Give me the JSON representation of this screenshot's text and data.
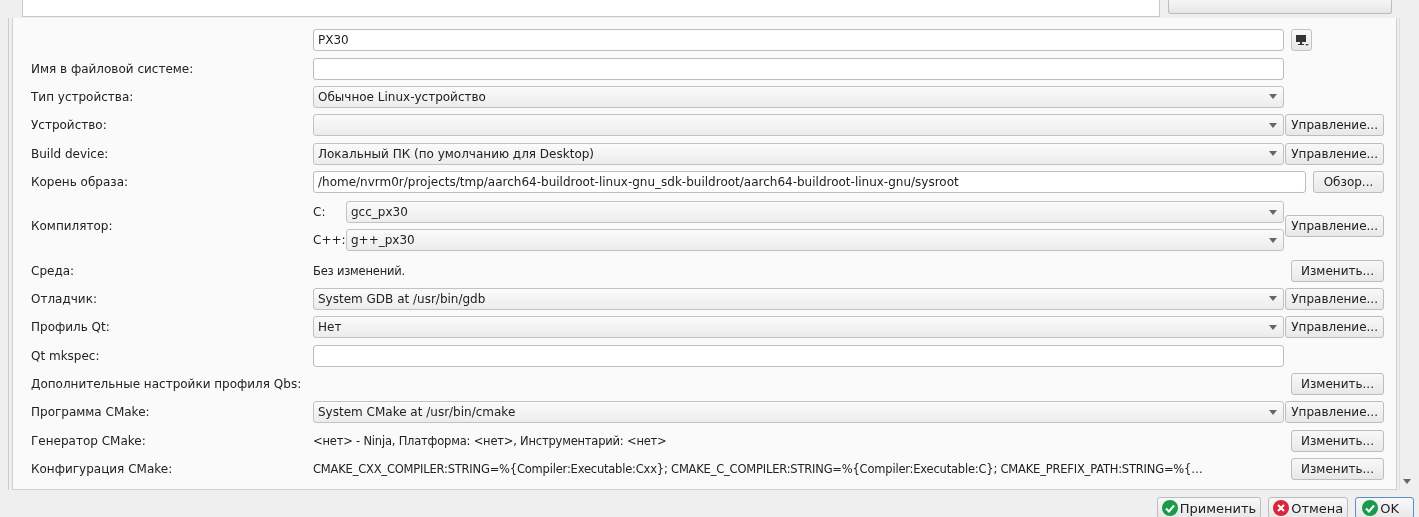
{
  "rows": [
    {
      "kind": "name",
      "value": "PX30"
    },
    {
      "label": "Имя в файловой системе:",
      "kind": "input"
    },
    {
      "label": "Тип устройства:",
      "kind": "combo",
      "value": "Обычное Linux-устройство"
    },
    {
      "label": "Устройство:",
      "kind": "combo",
      "button": "Управление..."
    },
    {
      "label": "Build device:",
      "kind": "combo",
      "value": "Локальный ПК (по умолчанию для Desktop)",
      "button": "Управление..."
    },
    {
      "label": "Корень образа:",
      "kind": "path",
      "value": "/home/nvrm0r/projects/tmp/aarch64-buildroot-linux-gnu_sdk-buildroot/aarch64-buildroot-linux-gnu/sysroot",
      "button": "Обзор..."
    },
    {
      "label": "Компилятор:",
      "kind": "compiler",
      "compilers": [
        {
          "lang": "C:",
          "value": "gcc_px30"
        },
        {
          "lang": "C++:",
          "value": "g++_px30"
        }
      ],
      "button": "Управление..."
    },
    {
      "label": "Среда:",
      "kind": "text",
      "value": "Без изменений.",
      "button": "Изменить..."
    },
    {
      "label": "Отладчик:",
      "kind": "combo",
      "value": "System GDB at /usr/bin/gdb",
      "button": "Управление..."
    },
    {
      "label": "Профиль Qt:",
      "kind": "combo",
      "value": "Нет",
      "button": "Управление..."
    },
    {
      "label": "Qt mkspec:",
      "kind": "input"
    },
    {
      "label": "Дополнительные настройки профиля Qbs:",
      "kind": "text",
      "button": "Изменить..."
    },
    {
      "label": "Программа CMake:",
      "kind": "combo",
      "value": "System CMake at /usr/bin/cmake",
      "button": "Управление..."
    },
    {
      "label": "Генератор CMake:",
      "kind": "text",
      "value": "<нет> - Ninja, Платформа: <нет>, Инструментарий: <нет>",
      "button": "Изменить..."
    },
    {
      "label": "Конфигурация CMake:",
      "kind": "text",
      "value": "CMAKE_CXX_COMPILER:STRING=%{Compiler:Executable:Cxx}; CMAKE_C_COMPILER:STRING=%{Compiler:Executable:C}; CMAKE_PREFIX_PATH:STRING=%{…",
      "button": "Изменить..."
    }
  ],
  "footer": [
    {
      "label": "Применить",
      "kind": "apply",
      "default": false
    },
    {
      "label": "Отмена",
      "kind": "cancel",
      "default": false
    },
    {
      "label": "OK",
      "kind": "ok",
      "default": true
    }
  ]
}
